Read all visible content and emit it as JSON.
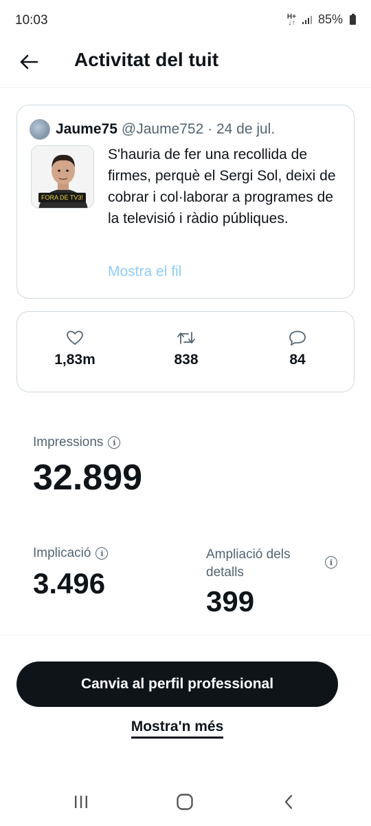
{
  "status_bar": {
    "time": "10:03",
    "network": "H+",
    "battery": "85%"
  },
  "header": {
    "title": "Activitat del tuit",
    "back_icon": "arrow-left-icon"
  },
  "tweet": {
    "author_name": "Jaume75",
    "author_meta": "@Jaume752 · 24 de jul.",
    "media_caption": "FORA DE TV3!",
    "text": "S'hauria de fer una recollida de firmes, perquè el Sergi Sol, deixi de cobrar i col·laborar a programes de la televisió i ràdio públiques.",
    "show_thread": "Mostra el fil"
  },
  "engagement": {
    "likes": "1,83m",
    "retweets": "838",
    "replies": "84"
  },
  "metrics": {
    "impressions_label": "Impressions",
    "impressions_value": "32.899",
    "engagement_label": "Implicació",
    "engagement_value": "3.496",
    "detail_label_line1": "Ampliació dels",
    "detail_label_line2": "detalls",
    "detail_value": "399"
  },
  "actions": {
    "pro_button": "Canvia al perfil professional",
    "show_more": "Mostra'n més"
  },
  "colors": {
    "accent_link": "#8ecdf8",
    "text_primary": "#0f1419",
    "text_secondary": "#536471",
    "border": "#cfd9de"
  }
}
